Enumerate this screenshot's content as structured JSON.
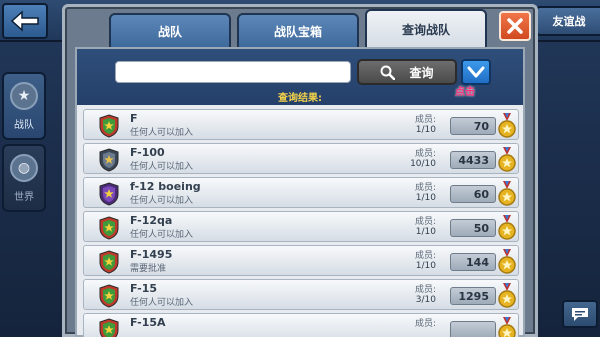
{
  "topbar": {
    "ally_war_label": "友谊战"
  },
  "sidebar": {
    "items": [
      {
        "label": "战队",
        "active": true
      },
      {
        "label": "世界",
        "active": false
      }
    ]
  },
  "panel": {
    "tabs": [
      {
        "label": "战队",
        "active": false
      },
      {
        "label": "战队宝箱",
        "active": false
      },
      {
        "label": "查询战队",
        "active": true
      }
    ],
    "search": {
      "value": "",
      "placeholder": "",
      "button_label": "查询"
    },
    "click_hint": "点击",
    "results_label": "查询结果:",
    "members_label": "成员:",
    "teams": [
      {
        "name": "F",
        "desc": "任何人可以加入",
        "members": "1/10",
        "score": "70",
        "badge": "green"
      },
      {
        "name": "F-100",
        "desc": "任何人可以加入",
        "members": "10/10",
        "score": "4433",
        "badge": "gray"
      },
      {
        "name": "f-12 boeing",
        "desc": "任何人可以加入",
        "members": "1/10",
        "score": "60",
        "badge": "purple"
      },
      {
        "name": "F-12qa",
        "desc": "任何人可以加入",
        "members": "1/10",
        "score": "50",
        "badge": "green"
      },
      {
        "name": "F-1495",
        "desc": "需要批准",
        "members": "1/10",
        "score": "144",
        "badge": "green"
      },
      {
        "name": "F-15",
        "desc": "任何人可以加入",
        "members": "3/10",
        "score": "1295",
        "badge": "green"
      },
      {
        "name": "F-15A",
        "desc": "",
        "members": "",
        "score": "",
        "badge": "green"
      }
    ]
  },
  "colors": {
    "accent_blue": "#1f6ec4",
    "close_orange": "#d14a1f",
    "results_yellow": "#f2d14a",
    "hint_pink": "#ff2f7a"
  }
}
